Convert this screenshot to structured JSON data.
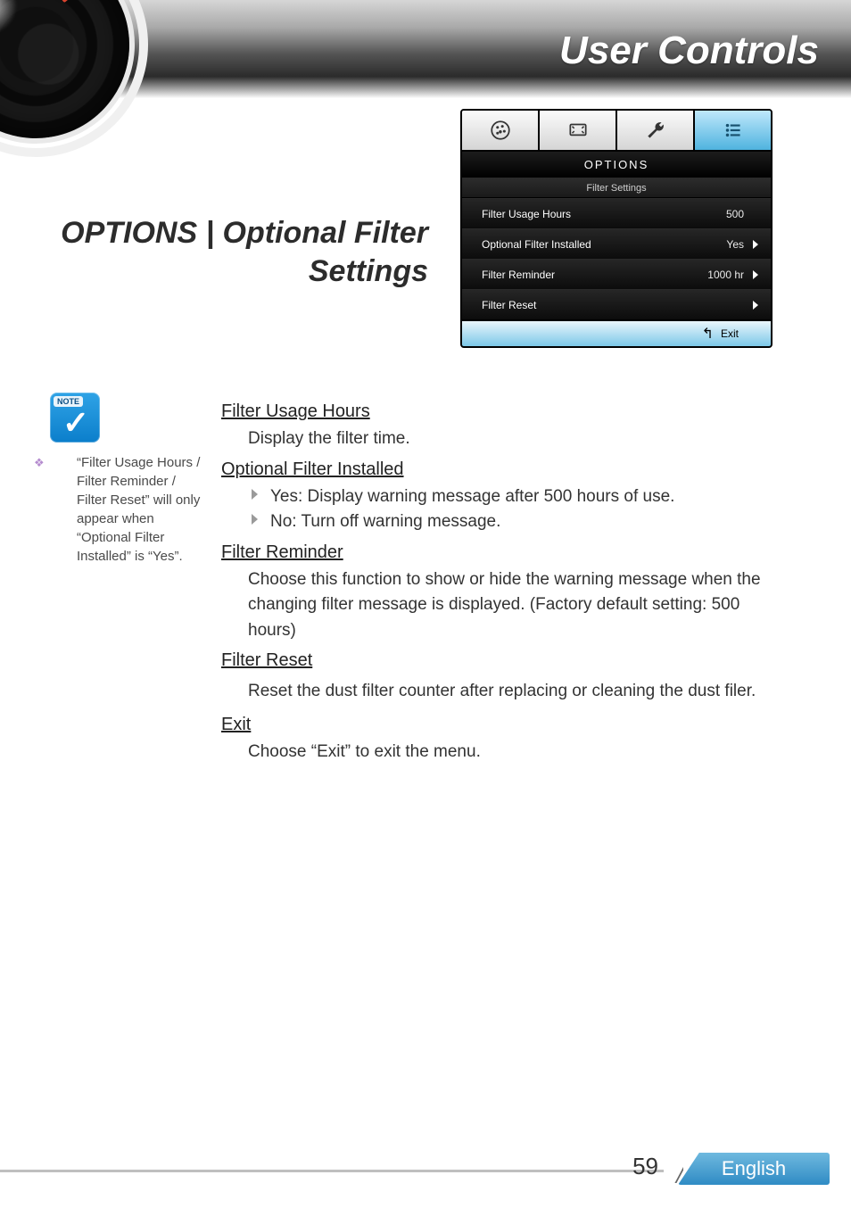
{
  "header": {
    "title": "User Controls"
  },
  "section": {
    "title": "OPTIONS | Optional Filter Settings"
  },
  "osd": {
    "heading": "OPTIONS",
    "subheading": "Filter Settings",
    "tabs": [
      {
        "name": "image-tab",
        "icon": "palette"
      },
      {
        "name": "display-tab",
        "icon": "screen"
      },
      {
        "name": "setup-tab",
        "icon": "wrench"
      },
      {
        "name": "options-tab",
        "icon": "list",
        "active": true
      }
    ],
    "rows": [
      {
        "label": "Filter Usage Hours",
        "value": "500",
        "arrow": false
      },
      {
        "label": "Optional Filter Installed",
        "value": "Yes",
        "arrow": true
      },
      {
        "label": "Filter Reminder",
        "value": "1000 hr",
        "arrow": true
      },
      {
        "label": "Filter Reset",
        "value": "",
        "arrow": true
      }
    ],
    "exit_label": "Exit"
  },
  "note": {
    "badge": "NOTE",
    "text": "“Filter Usage Hours / Filter Reminder / Filter Reset” will only appear when “Optional Filter Installed” is “Yes”."
  },
  "content": {
    "s1_title": "Filter Usage Hours",
    "s1_desc": "Display the filter time.",
    "s2_title": "Optional Filter Installed",
    "s2_b1": "Yes: Display warning message after 500 hours of use.",
    "s2_b2": "No: Turn off warning message.",
    "s3_title": "Filter Reminder",
    "s3_desc": "Choose this function to show or hide the warning message when the changing filter message is displayed. (Factory default setting: 500 hours)",
    "s4_title": "Filter Reset",
    "s4_desc": "Reset the dust filter counter after replacing or cleaning the dust filer.",
    "s5_title": "Exit",
    "s5_desc": "Choose “Exit” to exit the menu."
  },
  "footer": {
    "page": "59",
    "language": "English"
  }
}
